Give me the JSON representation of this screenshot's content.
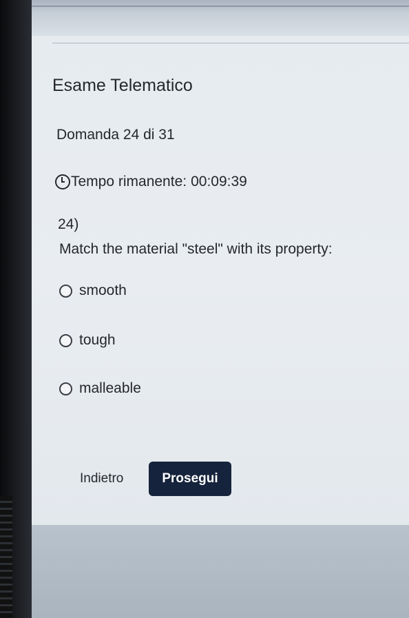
{
  "exam": {
    "title": "Esame Telematico",
    "question_counter": "Domanda 24 di 31",
    "timer_label": "Tempo rimanente:",
    "timer_value": "00:09:39"
  },
  "question": {
    "number": "24)",
    "text": "Match the material \"steel\" with its property:",
    "options": [
      "smooth",
      "tough",
      "malleable"
    ]
  },
  "buttons": {
    "back_label": "Indietro",
    "next_label": "Prosegui"
  },
  "colors": {
    "primary_button": "#16233c",
    "page_background": "#e6ebef"
  },
  "icons": {
    "timer": "clock-icon",
    "option": "radio-icon"
  }
}
